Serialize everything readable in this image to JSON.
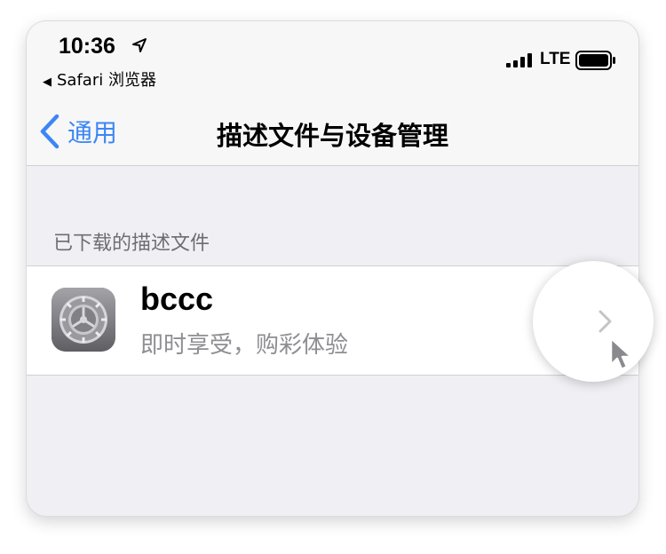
{
  "status_bar": {
    "time": "10:36",
    "back_app": "Safari 浏览器",
    "network": "LTE",
    "icons": [
      "location-icon",
      "signal-icon",
      "battery-icon"
    ]
  },
  "nav": {
    "back_label": "通用",
    "title": "描述文件与设备管理"
  },
  "section": {
    "header": "已下载的描述文件",
    "items": [
      {
        "title": "bccc",
        "subtitle": "即时享受，购彩体验",
        "icon": "settings-gear-icon"
      }
    ]
  },
  "colors": {
    "accent": "#3c86f5",
    "background": "#efeff4",
    "secondary_text": "#8e8e93",
    "section_text": "#6d6d72"
  }
}
